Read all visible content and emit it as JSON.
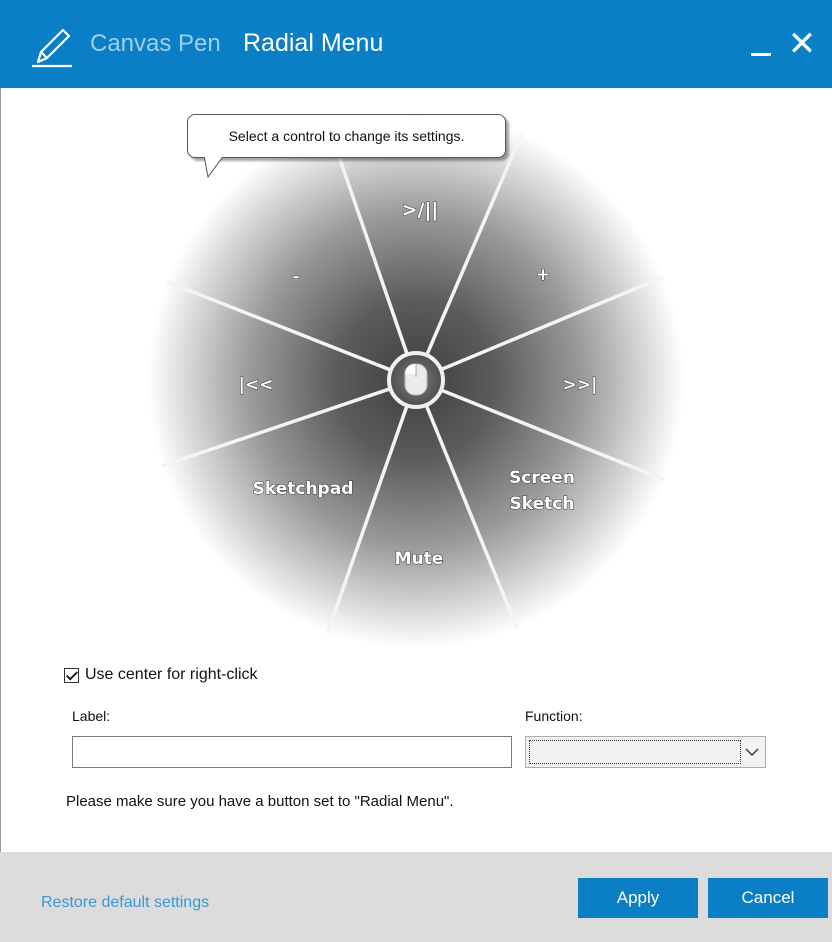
{
  "titlebar": {
    "app_name": "Canvas Pen",
    "window_title": "Radial Menu",
    "icon": "pen-icon",
    "minimize_icon": "minimize-icon",
    "close_icon": "close-icon",
    "close_glyph": "✕",
    "color": "#0a7fc5"
  },
  "tooltip": {
    "text": "Select a control to change its settings."
  },
  "radial_menu": {
    "segments": [
      {
        "label": ">/||",
        "name": "play-pause"
      },
      {
        "label": "+",
        "name": "volume-up"
      },
      {
        "label": ">>|",
        "name": "next-track"
      },
      {
        "label": "Screen\nSketch",
        "name": "screen-sketch"
      },
      {
        "label": "Mute",
        "name": "mute"
      },
      {
        "label": "Sketchpad",
        "name": "sketchpad"
      },
      {
        "label": "|<<",
        "name": "previous-track"
      },
      {
        "label": "-",
        "name": "volume-down"
      }
    ],
    "center_icon": "mouse-icon"
  },
  "options": {
    "use_center_label": "Use center for right-click",
    "use_center_checked": true,
    "label_field_label": "Label:",
    "label_value": "",
    "function_field_label": "Function:",
    "function_value": "",
    "hint": "Please make sure you have a button set to \"Radial Menu\"."
  },
  "footer": {
    "restore_label": "Restore default settings",
    "apply_label": "Apply",
    "cancel_label": "Cancel",
    "accent": "#0a7fc5",
    "link_color": "#3a98d6"
  }
}
